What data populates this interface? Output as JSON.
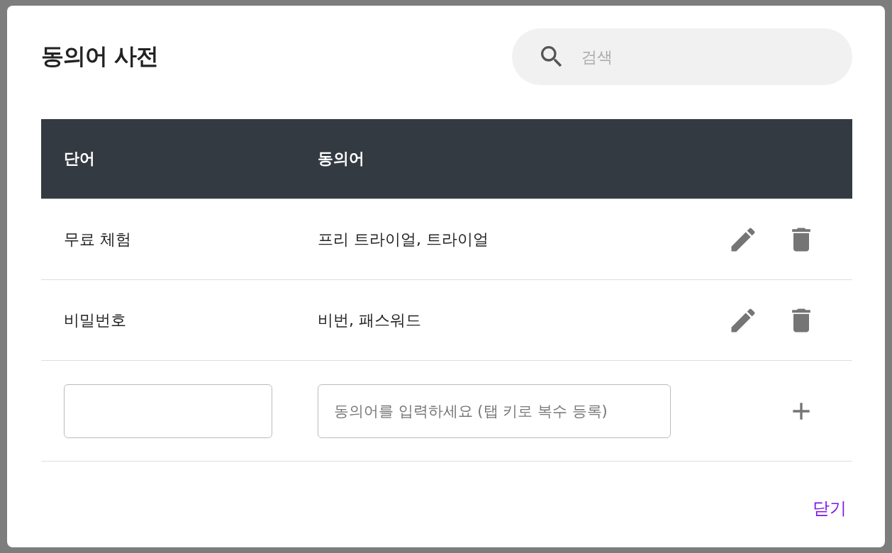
{
  "dialog": {
    "title": "동의어 사전",
    "search": {
      "placeholder": "검색"
    },
    "table": {
      "columns": [
        "단어",
        "동의어"
      ],
      "rows": [
        {
          "word": "무료 체험",
          "synonyms": "프리 트라이얼, 트라이얼"
        },
        {
          "word": "비밀번호",
          "synonyms": "비번, 패스워드"
        }
      ]
    },
    "new_row": {
      "synonyms_placeholder": "동의어를 입력하세요 (탭 키로 복수 등록)"
    },
    "buttons": [
      "닫기"
    ]
  }
}
